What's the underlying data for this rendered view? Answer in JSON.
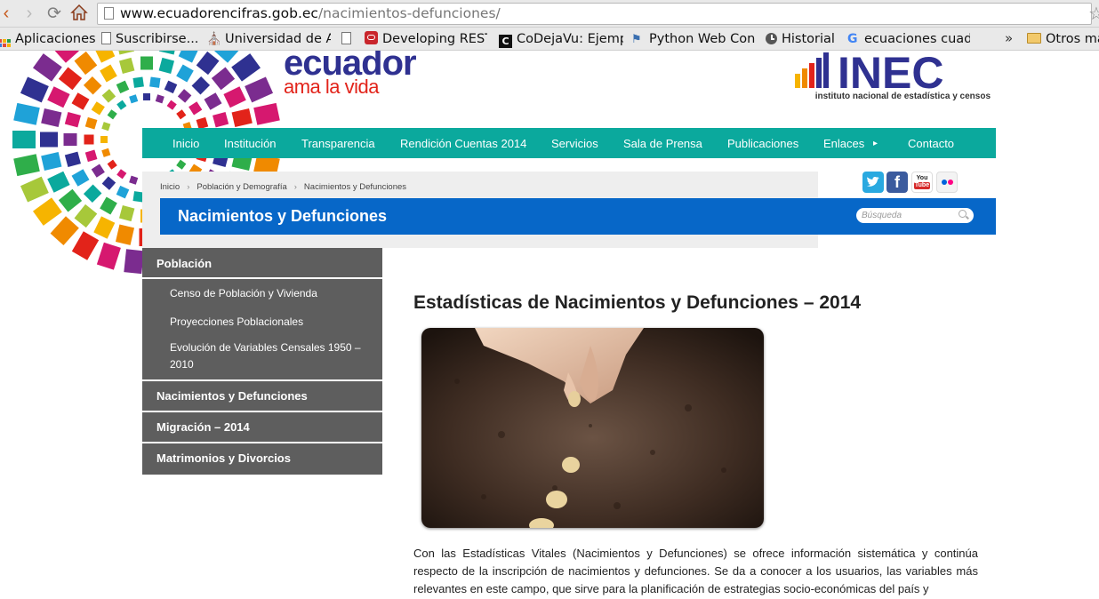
{
  "browser": {
    "url_host": "www.ecuadorencifras.gob.ec",
    "url_path": "/nacimientos-defunciones/",
    "bookmarks": [
      {
        "label": "Aplicaciones",
        "icon": "apps-grid-icon"
      },
      {
        "label": "Suscribirse...",
        "icon": "page-icon"
      },
      {
        "label": "Universidad de Al",
        "icon": "university-icon"
      },
      {
        "label": "",
        "icon": "page-icon"
      },
      {
        "label": "Developing REST",
        "icon": "oracle-icon"
      },
      {
        "label": "CoDejaVu: Ejemp",
        "icon": "codejavu-icon"
      },
      {
        "label": "Python Web Cons",
        "icon": "python-icon"
      },
      {
        "label": "Historial",
        "icon": "history-icon"
      },
      {
        "label": "ecuaciones cuadr",
        "icon": "google-icon"
      }
    ],
    "more_bookmarks": "»",
    "other_bookmarks": "Otros ma"
  },
  "header": {
    "logo_line1": "ecuador",
    "logo_line2": "ama la vida",
    "inec_name": "INEC",
    "inec_tagline": "instituto nacional de estadística y censos",
    "colors": {
      "brand_blue": "#2f3191",
      "brand_red": "#e2231a",
      "nav_teal": "#0ba99d",
      "title_blue": "#0767c8"
    }
  },
  "nav": {
    "items": [
      "Inicio",
      "Institución",
      "Transparencia",
      "Rendición Cuentas 2014",
      "Servicios",
      "Sala de Prensa",
      "Publicaciones",
      "Enlaces",
      "Contacto"
    ],
    "enlaces_arrow": "▸"
  },
  "breadcrumb": {
    "items": [
      "Inicio",
      "Población y Demografía",
      "Nacimientos y Defunciones"
    ],
    "separator": "›"
  },
  "page_title": "Nacimientos y Defunciones",
  "search": {
    "placeholder": "Búsqueda"
  },
  "social": [
    "twitter-icon",
    "facebook-icon",
    "youtube-icon",
    "flickr-icon"
  ],
  "sidebar": {
    "sections": [
      {
        "label": "Población",
        "children": [
          "Censo de Población y Vivienda",
          "Proyecciones Poblacionales",
          "Evolución de Variables Censales 1950 – 2010"
        ]
      },
      {
        "label": "Nacimientos y Defunciones",
        "children": []
      },
      {
        "label": "Migración – 2014",
        "children": []
      },
      {
        "label": "Matrimonios y Divorcios",
        "children": []
      }
    ]
  },
  "content": {
    "title": "Estadísticas de Nacimientos y Defunciones – 2014",
    "image_alt": "hand-planting-seeds-photo",
    "paragraph": "Con las Estadísticas Vitales (Nacimientos y Defunciones) se ofrece información sistemática y continúa respecto de la inscripción de nacimientos y defunciones. Se da a conocer a los usuarios, las variables más relevantes en este campo, que sirve para la planificación de estrategias socio-económicas del país y"
  }
}
